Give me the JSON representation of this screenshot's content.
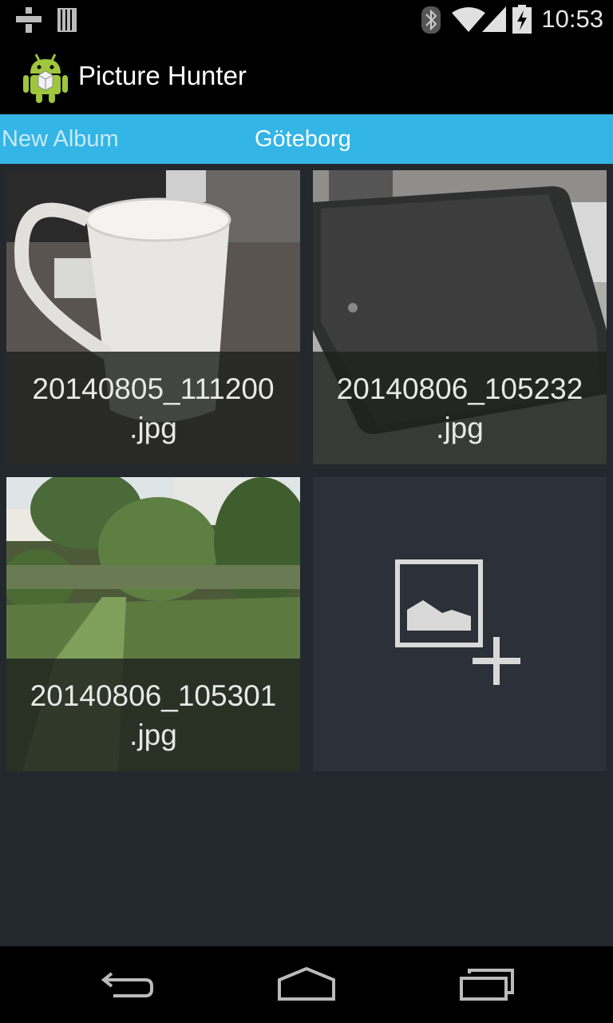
{
  "status_bar": {
    "time": "10:53",
    "left_icons": [
      "notification-app-icon",
      "storage-icon"
    ],
    "right_icons": [
      "bluetooth-icon",
      "wifi-icon",
      "cell-signal-icon",
      "battery-charging-icon"
    ]
  },
  "action_bar": {
    "title": "Picture Hunter",
    "icon": "android-app-icon"
  },
  "tabs": {
    "previous": "New Album",
    "current": "Göteborg"
  },
  "grid": {
    "items": [
      {
        "filename_line1": "20140805_111200",
        "filename_line2": ".jpg"
      },
      {
        "filename_line1": "20140806_105232",
        "filename_line2": ".jpg"
      },
      {
        "filename_line1": "20140806_105301",
        "filename_line2": ".jpg"
      }
    ],
    "add_tile_icon": "add-picture-icon"
  },
  "nav_bar": {
    "icons": [
      "back-icon",
      "home-icon",
      "recents-icon"
    ]
  },
  "colors": {
    "accent": "#33b5e5",
    "background": "#23272e",
    "tile": "#2c3038"
  }
}
